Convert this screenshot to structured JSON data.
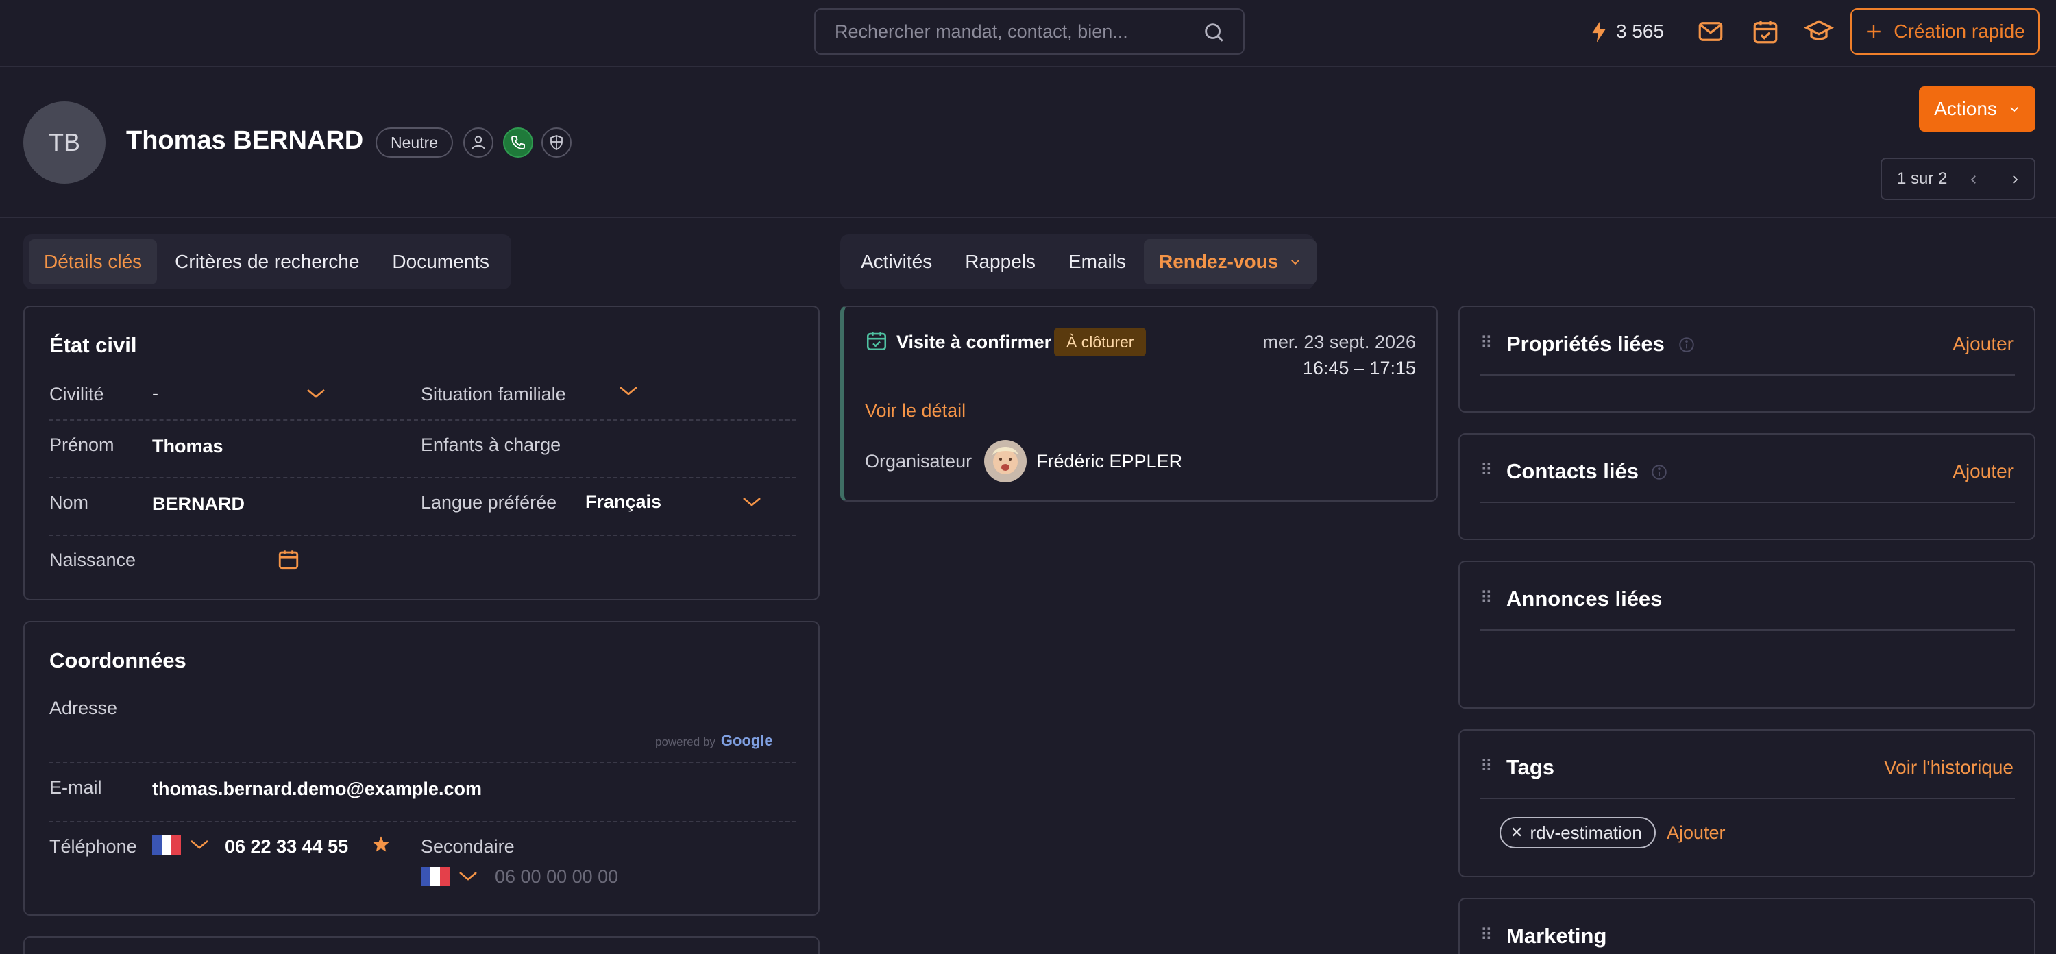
{
  "search": {
    "placeholder": "Rechercher mandat, contact, bien..."
  },
  "topbar": {
    "credits": "3 565",
    "quick_create": "Création rapide"
  },
  "contact": {
    "initials": "TB",
    "name": "Thomas BERNARD",
    "status_badge": "Neutre"
  },
  "header": {
    "actions_label": "Actions",
    "pager": "1 sur 2"
  },
  "tabs_left": [
    "Détails clés",
    "Critères de recherche",
    "Documents"
  ],
  "tabs_right": [
    "Activités",
    "Rappels",
    "Emails",
    "Rendez-vous"
  ],
  "etat_civil": {
    "title": "État civil",
    "civilite_label": "Civilité",
    "civilite_value": "-",
    "situation_label": "Situation familiale",
    "prenom_label": "Prénom",
    "prenom_value": "Thomas",
    "enfants_label": "Enfants à charge",
    "nom_label": "Nom",
    "nom_value": "BERNARD",
    "langue_label": "Langue préférée",
    "langue_value": "Français",
    "naissance_label": "Naissance"
  },
  "coordonnees": {
    "title": "Coordonnées",
    "adresse_label": "Adresse",
    "powered_by": "powered by",
    "google": "Google",
    "email_label": "E-mail",
    "email_value": "thomas.bernard.demo@example.com",
    "telephone_label": "Téléphone",
    "telephone_value": "06 22 33 44 55",
    "secondaire_label": "Secondaire",
    "secondaire_placeholder": "06 00 00 00 00"
  },
  "rdv": {
    "title": "Visite à confirmer",
    "badge": "À clôturer",
    "date": "mer. 23 sept. 2026",
    "time": "16:45 – 17:15",
    "detail_link": "Voir le détail",
    "organizer_label": "Organisateur",
    "organizer_name": "Frédéric EPPLER"
  },
  "side": {
    "proprietes": {
      "title": "Propriétés liées",
      "action": "Ajouter"
    },
    "contacts": {
      "title": "Contacts liés",
      "action": "Ajouter"
    },
    "annonces": {
      "title": "Annonces liées"
    },
    "tags": {
      "title": "Tags",
      "action": "Voir l'historique",
      "items": [
        "rdv-estimation"
      ],
      "add": "Ajouter"
    },
    "marketing": {
      "title": "Marketing"
    }
  },
  "colors": {
    "accent": "#f49447",
    "button": "#f26b0f",
    "bg": "#1d1c29",
    "phone_green": "#1f7a3a",
    "badge_bg": "#5a3a0e"
  }
}
